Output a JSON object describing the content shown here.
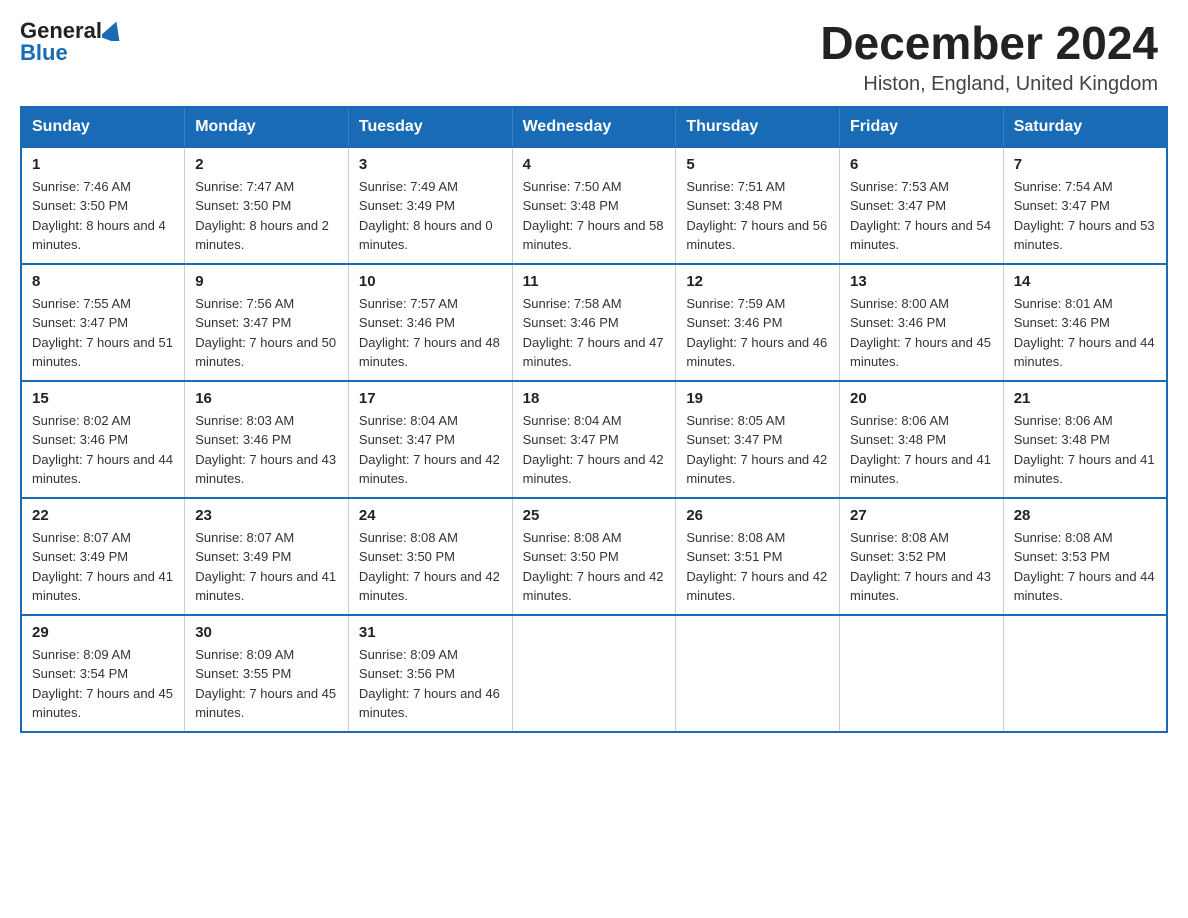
{
  "header": {
    "logo_text_general": "General",
    "logo_text_blue": "Blue",
    "month_title": "December 2024",
    "location": "Histon, England, United Kingdom"
  },
  "days_of_week": [
    "Sunday",
    "Monday",
    "Tuesday",
    "Wednesday",
    "Thursday",
    "Friday",
    "Saturday"
  ],
  "weeks": [
    [
      {
        "day": "1",
        "sunrise": "7:46 AM",
        "sunset": "3:50 PM",
        "daylight": "8 hours and 4 minutes."
      },
      {
        "day": "2",
        "sunrise": "7:47 AM",
        "sunset": "3:50 PM",
        "daylight": "8 hours and 2 minutes."
      },
      {
        "day": "3",
        "sunrise": "7:49 AM",
        "sunset": "3:49 PM",
        "daylight": "8 hours and 0 minutes."
      },
      {
        "day": "4",
        "sunrise": "7:50 AM",
        "sunset": "3:48 PM",
        "daylight": "7 hours and 58 minutes."
      },
      {
        "day": "5",
        "sunrise": "7:51 AM",
        "sunset": "3:48 PM",
        "daylight": "7 hours and 56 minutes."
      },
      {
        "day": "6",
        "sunrise": "7:53 AM",
        "sunset": "3:47 PM",
        "daylight": "7 hours and 54 minutes."
      },
      {
        "day": "7",
        "sunrise": "7:54 AM",
        "sunset": "3:47 PM",
        "daylight": "7 hours and 53 minutes."
      }
    ],
    [
      {
        "day": "8",
        "sunrise": "7:55 AM",
        "sunset": "3:47 PM",
        "daylight": "7 hours and 51 minutes."
      },
      {
        "day": "9",
        "sunrise": "7:56 AM",
        "sunset": "3:47 PM",
        "daylight": "7 hours and 50 minutes."
      },
      {
        "day": "10",
        "sunrise": "7:57 AM",
        "sunset": "3:46 PM",
        "daylight": "7 hours and 48 minutes."
      },
      {
        "day": "11",
        "sunrise": "7:58 AM",
        "sunset": "3:46 PM",
        "daylight": "7 hours and 47 minutes."
      },
      {
        "day": "12",
        "sunrise": "7:59 AM",
        "sunset": "3:46 PM",
        "daylight": "7 hours and 46 minutes."
      },
      {
        "day": "13",
        "sunrise": "8:00 AM",
        "sunset": "3:46 PM",
        "daylight": "7 hours and 45 minutes."
      },
      {
        "day": "14",
        "sunrise": "8:01 AM",
        "sunset": "3:46 PM",
        "daylight": "7 hours and 44 minutes."
      }
    ],
    [
      {
        "day": "15",
        "sunrise": "8:02 AM",
        "sunset": "3:46 PM",
        "daylight": "7 hours and 44 minutes."
      },
      {
        "day": "16",
        "sunrise": "8:03 AM",
        "sunset": "3:46 PM",
        "daylight": "7 hours and 43 minutes."
      },
      {
        "day": "17",
        "sunrise": "8:04 AM",
        "sunset": "3:47 PM",
        "daylight": "7 hours and 42 minutes."
      },
      {
        "day": "18",
        "sunrise": "8:04 AM",
        "sunset": "3:47 PM",
        "daylight": "7 hours and 42 minutes."
      },
      {
        "day": "19",
        "sunrise": "8:05 AM",
        "sunset": "3:47 PM",
        "daylight": "7 hours and 42 minutes."
      },
      {
        "day": "20",
        "sunrise": "8:06 AM",
        "sunset": "3:48 PM",
        "daylight": "7 hours and 41 minutes."
      },
      {
        "day": "21",
        "sunrise": "8:06 AM",
        "sunset": "3:48 PM",
        "daylight": "7 hours and 41 minutes."
      }
    ],
    [
      {
        "day": "22",
        "sunrise": "8:07 AM",
        "sunset": "3:49 PM",
        "daylight": "7 hours and 41 minutes."
      },
      {
        "day": "23",
        "sunrise": "8:07 AM",
        "sunset": "3:49 PM",
        "daylight": "7 hours and 41 minutes."
      },
      {
        "day": "24",
        "sunrise": "8:08 AM",
        "sunset": "3:50 PM",
        "daylight": "7 hours and 42 minutes."
      },
      {
        "day": "25",
        "sunrise": "8:08 AM",
        "sunset": "3:50 PM",
        "daylight": "7 hours and 42 minutes."
      },
      {
        "day": "26",
        "sunrise": "8:08 AM",
        "sunset": "3:51 PM",
        "daylight": "7 hours and 42 minutes."
      },
      {
        "day": "27",
        "sunrise": "8:08 AM",
        "sunset": "3:52 PM",
        "daylight": "7 hours and 43 minutes."
      },
      {
        "day": "28",
        "sunrise": "8:08 AM",
        "sunset": "3:53 PM",
        "daylight": "7 hours and 44 minutes."
      }
    ],
    [
      {
        "day": "29",
        "sunrise": "8:09 AM",
        "sunset": "3:54 PM",
        "daylight": "7 hours and 45 minutes."
      },
      {
        "day": "30",
        "sunrise": "8:09 AM",
        "sunset": "3:55 PM",
        "daylight": "7 hours and 45 minutes."
      },
      {
        "day": "31",
        "sunrise": "8:09 AM",
        "sunset": "3:56 PM",
        "daylight": "7 hours and 46 minutes."
      },
      null,
      null,
      null,
      null
    ]
  ]
}
